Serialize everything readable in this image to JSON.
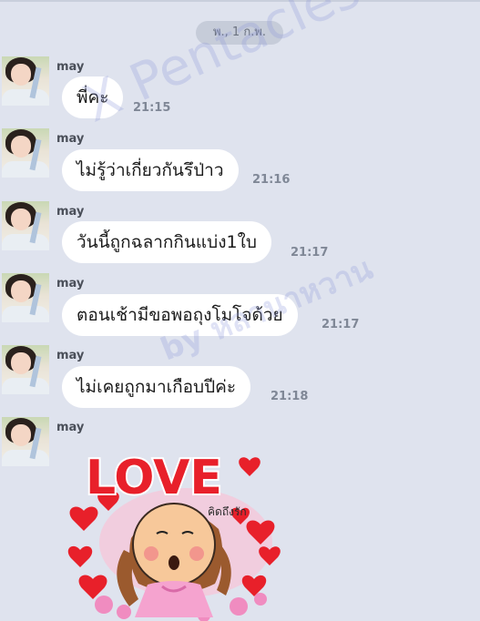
{
  "chat": {
    "date_label": "พ., 1 ก.พ.",
    "messages": [
      {
        "sender": "may",
        "text": "พี่คะ",
        "time": "21:15"
      },
      {
        "sender": "may",
        "text": "ไม่รู้ว่าเกี่ยวกันรึป่าว",
        "time": "21:16"
      },
      {
        "sender": "may",
        "text": "วันนี้ถูกฉลากกินแบ่ง1ใบ",
        "time": "21:17"
      },
      {
        "sender": "may",
        "text": "ตอนเช้ามีขอพอถุงโมโจด้วย",
        "time": "21:17"
      },
      {
        "sender": "may",
        "text": "ไม่เคยถูกมาเกือบปีค่ะ",
        "time": "21:18"
      }
    ],
    "sticker_message": {
      "sender": "may",
      "sticker_text": "LOVE",
      "sticker_caption": "คิดถึงรัก"
    }
  },
  "watermark": {
    "line1": "X Pentacles",
    "line2": "by หลานาหวาน"
  },
  "colors": {
    "background": "#dfe3ee",
    "bubble": "#ffffff",
    "date_pill": "#c6ccd9",
    "heart": "#e8202a"
  }
}
